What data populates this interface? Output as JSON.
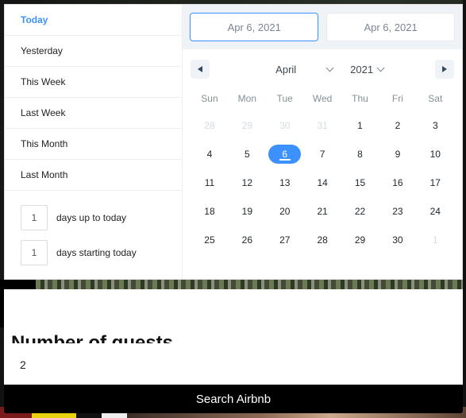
{
  "ranges": {
    "static": [
      {
        "label": "Today",
        "active": true
      },
      {
        "label": "Yesterday"
      },
      {
        "label": "This Week"
      },
      {
        "label": "Last Week"
      },
      {
        "label": "This Month"
      },
      {
        "label": "Last Month"
      }
    ],
    "inputs": [
      {
        "value": "1",
        "label": "days up to today"
      },
      {
        "value": "1",
        "label": "days starting today"
      }
    ]
  },
  "date_display": {
    "start": "Apr 6, 2021",
    "end": "Apr 6, 2021"
  },
  "month_nav": {
    "month": "April",
    "year": "2021"
  },
  "weekdays": [
    "Sun",
    "Mon",
    "Tue",
    "Wed",
    "Thu",
    "Fri",
    "Sat"
  ],
  "days": [
    {
      "d": "28",
      "passive": true
    },
    {
      "d": "29",
      "passive": true
    },
    {
      "d": "30",
      "passive": true
    },
    {
      "d": "31",
      "passive": true
    },
    {
      "d": "1"
    },
    {
      "d": "2"
    },
    {
      "d": "3"
    },
    {
      "d": "4"
    },
    {
      "d": "5"
    },
    {
      "d": "6",
      "selected": true
    },
    {
      "d": "7"
    },
    {
      "d": "8"
    },
    {
      "d": "9"
    },
    {
      "d": "10"
    },
    {
      "d": "11"
    },
    {
      "d": "12"
    },
    {
      "d": "13"
    },
    {
      "d": "14"
    },
    {
      "d": "15"
    },
    {
      "d": "16"
    },
    {
      "d": "17"
    },
    {
      "d": "18"
    },
    {
      "d": "19"
    },
    {
      "d": "20"
    },
    {
      "d": "21"
    },
    {
      "d": "22"
    },
    {
      "d": "23"
    },
    {
      "d": "24"
    },
    {
      "d": "25"
    },
    {
      "d": "26"
    },
    {
      "d": "27"
    },
    {
      "d": "28"
    },
    {
      "d": "29"
    },
    {
      "d": "30"
    },
    {
      "d": "1",
      "passive": true
    }
  ],
  "form": {
    "heading": "Number of guests",
    "guests_value": "2",
    "search_label": "Search Airbnb"
  },
  "colors": {
    "accent": "#3d91ff"
  }
}
